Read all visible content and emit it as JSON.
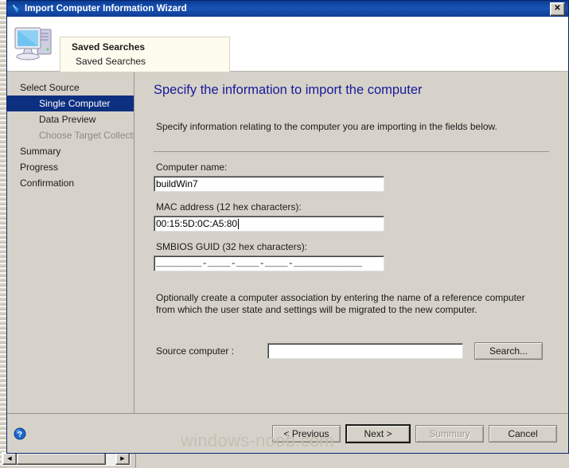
{
  "window": {
    "title": "Import Computer Information Wizard",
    "title_icon": "import-arrow-icon",
    "close_label": "✕",
    "header_icon": "computer-icon",
    "title_bar_color": "#0a3d91",
    "accent_color": "#0c2f80"
  },
  "tooltip": {
    "title": "Saved Searches",
    "body": "Saved Searches"
  },
  "sidebar": {
    "items": [
      {
        "label": "Select Source",
        "level": 0,
        "state": "normal"
      },
      {
        "label": "Single Computer",
        "level": 1,
        "state": "selected"
      },
      {
        "label": "Data Preview",
        "level": 1,
        "state": "normal"
      },
      {
        "label": "Choose Target Collection",
        "level": 1,
        "state": "dim"
      },
      {
        "label": "Summary",
        "level": 0,
        "state": "normal"
      },
      {
        "label": "Progress",
        "level": 0,
        "state": "normal"
      },
      {
        "label": "Confirmation",
        "level": 0,
        "state": "normal"
      }
    ]
  },
  "main": {
    "page_title": "Specify the information to import the computer",
    "intro_text": "Specify information relating to the computer you are importing in the fields below.",
    "fields": {
      "computer_name": {
        "label": "Computer name:",
        "value": "buildWin7",
        "placeholder": ""
      },
      "mac_address": {
        "label": "MAC address (12 hex characters):",
        "value": "00:15:5D:0C:A5:80",
        "placeholder": ""
      },
      "smbios_guid": {
        "label": "SMBIOS GUID (32 hex characters):",
        "value": "________-____-____-____-____________",
        "placeholder": ""
      }
    },
    "association_text": "Optionally create a computer association by entering the name of a reference computer from which the user state and settings will be migrated to the new computer.",
    "source_computer": {
      "label": "Source computer :",
      "value": "",
      "placeholder": ""
    },
    "search_button": "Search..."
  },
  "footer": {
    "help_icon": "help-question-icon",
    "watermark": "windows-noob.com",
    "buttons": [
      {
        "label": "< Previous",
        "state": "normal"
      },
      {
        "label": "Next >",
        "state": "default"
      },
      {
        "label": "Summary",
        "state": "disabled"
      },
      {
        "label": "Cancel",
        "state": "normal"
      }
    ]
  },
  "background_window": {
    "scrollbar_left_arrow": "◀",
    "scrollbar_right_arrow": "▶"
  }
}
